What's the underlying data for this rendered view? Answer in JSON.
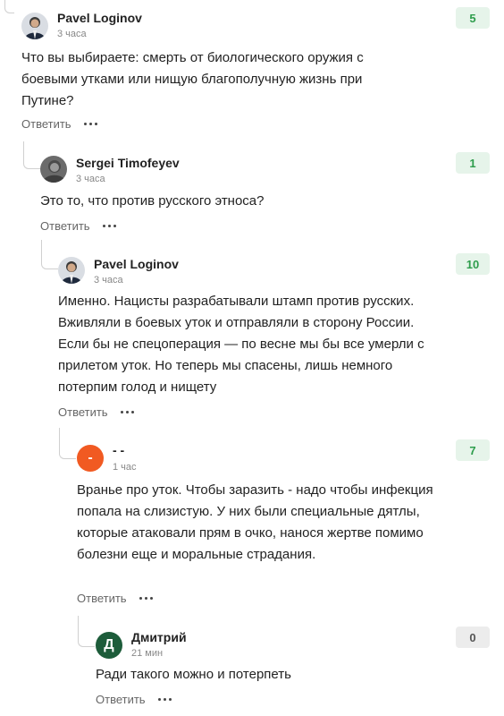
{
  "comments": [
    {
      "author": "Pavel Loginov",
      "time": "3 часа",
      "score": "5",
      "text": "Что вы выбираете: смерть от биологического оружия с боевыми утками или нищую благополучную жизнь при Путине?",
      "reply_label": "Ответить",
      "avatar_icon": "person-photo-icon"
    },
    {
      "author": "Sergei Timofeyev",
      "time": "3 часа",
      "score": "1",
      "text": "Это то, что против русского этноса?",
      "reply_label": "Ответить",
      "avatar_icon": "person-photo-icon"
    },
    {
      "author": "Pavel Loginov",
      "time": "3 часа",
      "score": "10",
      "text": "Именно. Нацисты разрабатывали штамп против русских. Вживляли в боевых уток и отправляли в сторону России. Если бы не спецоперация — по весне мы бы все умерли с прилетом уток. Но теперь мы спасены, лишь немного потерпим голод и нищету",
      "reply_label": "Ответить",
      "avatar_icon": "person-photo-icon"
    },
    {
      "author": "- -",
      "time": "1 час",
      "score": "7",
      "text": "Вранье про уток. Чтобы заразить - надо чтобы инфекция попала на слизистую. У них были специальные дятлы, которые атаковали прям в очко, нанося жертве помимо болезни еще и моральные страдания.",
      "reply_label": "Ответить",
      "avatar_letter": "-",
      "avatar_color": "#f15a22"
    },
    {
      "author": "Дмитрий",
      "time": "21 мин",
      "score": "0",
      "text": "Ради такого можно и потерпеть",
      "reply_label": "Ответить",
      "avatar_letter": "Д",
      "avatar_color": "#1d5c3a"
    }
  ],
  "colors": {
    "score_positive_bg": "#e6f4ea",
    "score_positive_text": "#2e9d4c",
    "score_neutral_bg": "#ececec"
  }
}
